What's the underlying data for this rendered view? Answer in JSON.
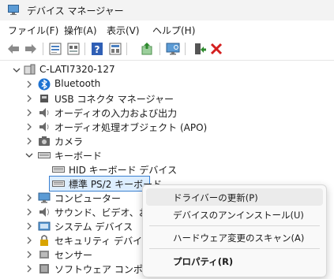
{
  "window": {
    "title": "デバイス マネージャー"
  },
  "menu": [
    "ファイル(F)",
    "操作(A)",
    "表示(V)",
    "ヘルプ(H)"
  ],
  "toolbar": {
    "icons": [
      "back-arrow-icon",
      "forward-arrow-icon",
      "properties-icon",
      "show-hidden-icon",
      "help-icon",
      "driver-view-icon",
      "update-driver-icon",
      "scan-hardware-icon",
      "enable-device-icon",
      "uninstall-device-icon"
    ]
  },
  "tree": {
    "root": "C-LATI7320-127",
    "items": [
      {
        "label": "Bluetooth",
        "icon": "bluetooth-icon"
      },
      {
        "label": "USB コネクタ マネージャー",
        "icon": "usb-icon"
      },
      {
        "label": "オーディオの入力および出力",
        "icon": "speaker-icon"
      },
      {
        "label": "オーディオ処理オブジェクト (APO)",
        "icon": "speaker-icon"
      },
      {
        "label": "カメラ",
        "icon": "camera-icon"
      },
      {
        "label": "キーボード",
        "icon": "keyboard-icon"
      },
      {
        "label": "HID キーボード デバイス",
        "icon": "keyboard-icon"
      },
      {
        "label": "標準 PS/2 キーボード",
        "icon": "keyboard-icon"
      },
      {
        "label": "コンピューター",
        "icon": "computer-icon"
      },
      {
        "label": "サウンド、ビデオ、およびゲーム",
        "icon": "sound-icon"
      },
      {
        "label": "システム デバイス",
        "icon": "system-icon"
      },
      {
        "label": "セキュリティ デバイス",
        "icon": "security-icon"
      },
      {
        "label": "センサー",
        "icon": "sensor-icon"
      },
      {
        "label": "ソフトウェア コンポーネント",
        "icon": "software-icon"
      }
    ]
  },
  "context_menu": {
    "items": [
      "ドライバーの更新(P)",
      "デバイスのアンインストール(U)",
      "ハードウェア変更のスキャン(A)",
      "プロパティ(R)"
    ]
  }
}
